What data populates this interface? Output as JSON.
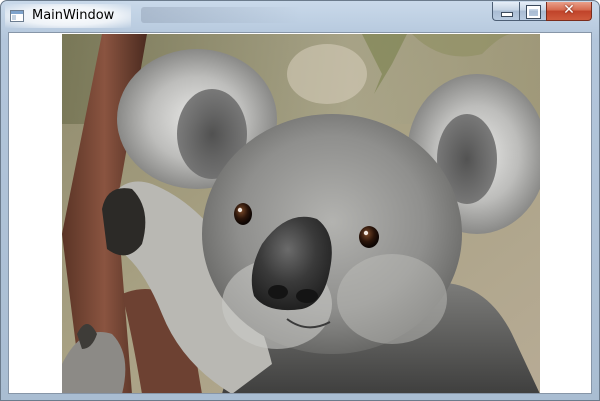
{
  "window": {
    "title": "MainWindow",
    "app_icon": "window-app-icon"
  },
  "caption_buttons": {
    "minimize_icon": "minimize-icon",
    "maximize_icon": "maximize-icon",
    "close_icon": "close-icon",
    "close_glyph": "✕",
    "close_color": "#c7462b"
  },
  "content": {
    "image_subject": "koala"
  }
}
